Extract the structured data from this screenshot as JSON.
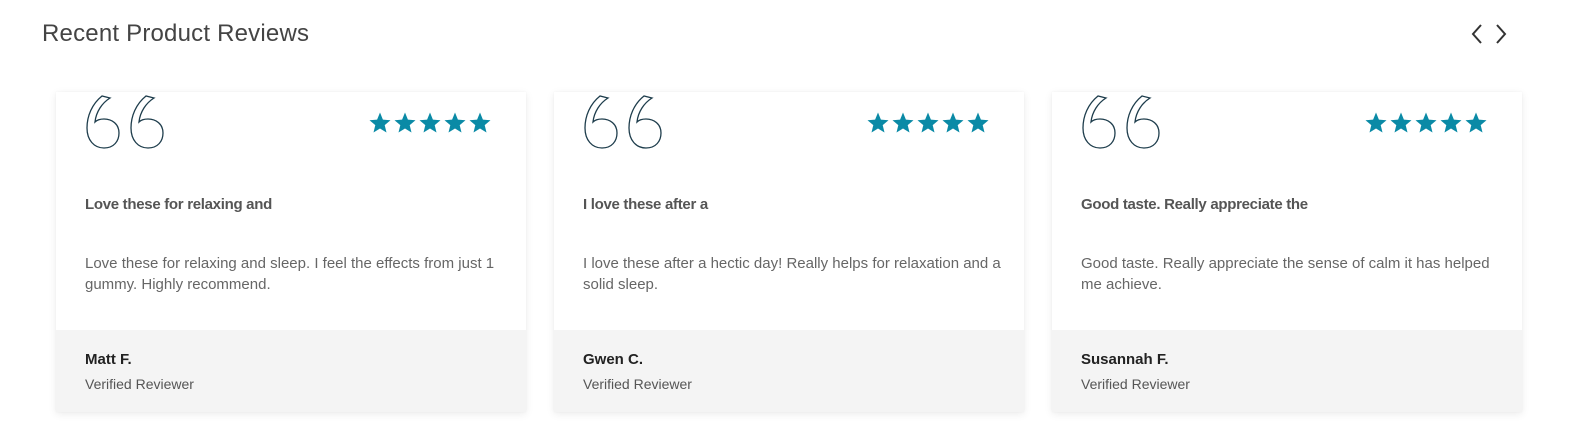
{
  "section": {
    "title": "Recent Product Reviews"
  },
  "nav": {
    "prev_icon": "chevron-left-icon",
    "next_icon": "chevron-right-icon"
  },
  "colors": {
    "star": "#0a8aa6",
    "quote_stroke": "#1e3d4c"
  },
  "reviews": [
    {
      "rating": 5,
      "title": "Love these for relaxing and",
      "body": "Love these for relaxing and sleep. I feel the effects from just 1 gummy. Highly recommend.",
      "reviewer": "Matt F.",
      "badge": "Verified Reviewer"
    },
    {
      "rating": 5,
      "title": "I love these after a",
      "body": "I love these after a hectic day! Really helps for relaxation and a solid sleep.",
      "reviewer": "Gwen C.",
      "badge": "Verified Reviewer"
    },
    {
      "rating": 5,
      "title": "Good taste. Really appreciate the",
      "body": "Good taste. Really appreciate the sense of calm it has helped me achieve.",
      "reviewer": "Susannah F.",
      "badge": "Verified Reviewer"
    }
  ]
}
